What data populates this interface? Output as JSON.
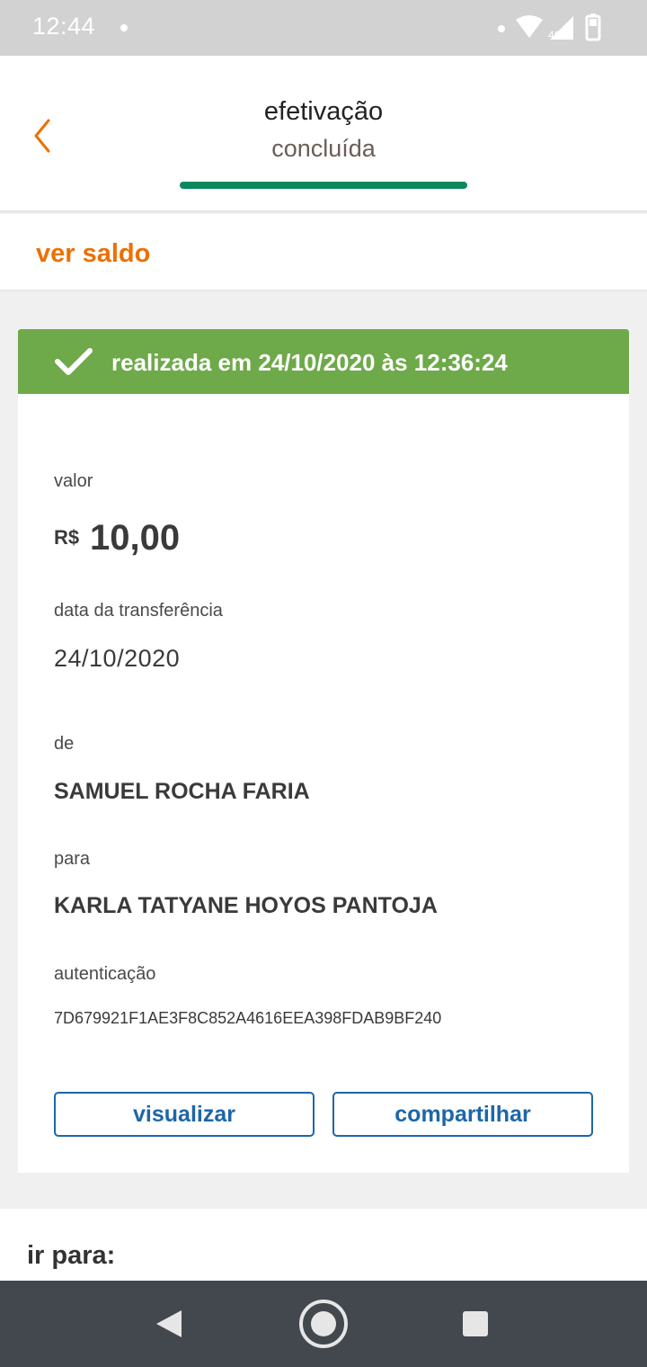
{
  "status_bar": {
    "time": "12:44",
    "network": "4G"
  },
  "header": {
    "title": "efetivação",
    "subtitle": "concluída",
    "accent_color": "#ec7000",
    "progress_color": "#0a8a5c"
  },
  "saldo": {
    "label": "ver saldo"
  },
  "receipt": {
    "banner": {
      "text": "realizada em 24/10/2020 às 12:36:24",
      "color": "#6ea94a"
    },
    "valor": {
      "label": "valor",
      "currency": "R$",
      "amount": "10,00"
    },
    "data": {
      "label": "data da transferência",
      "value": "24/10/2020"
    },
    "de": {
      "label": "de",
      "value": "SAMUEL ROCHA FARIA"
    },
    "para": {
      "label": "para",
      "value": "KARLA TATYANE HOYOS PANTOJA"
    },
    "autenticacao": {
      "label": "autenticação",
      "value": "7D679921F1AE3F8C852A4616EEA398FDAB9BF240"
    },
    "buttons": {
      "view": "visualizar",
      "share": "compartilhar"
    }
  },
  "goto": {
    "label": "ir para:"
  }
}
